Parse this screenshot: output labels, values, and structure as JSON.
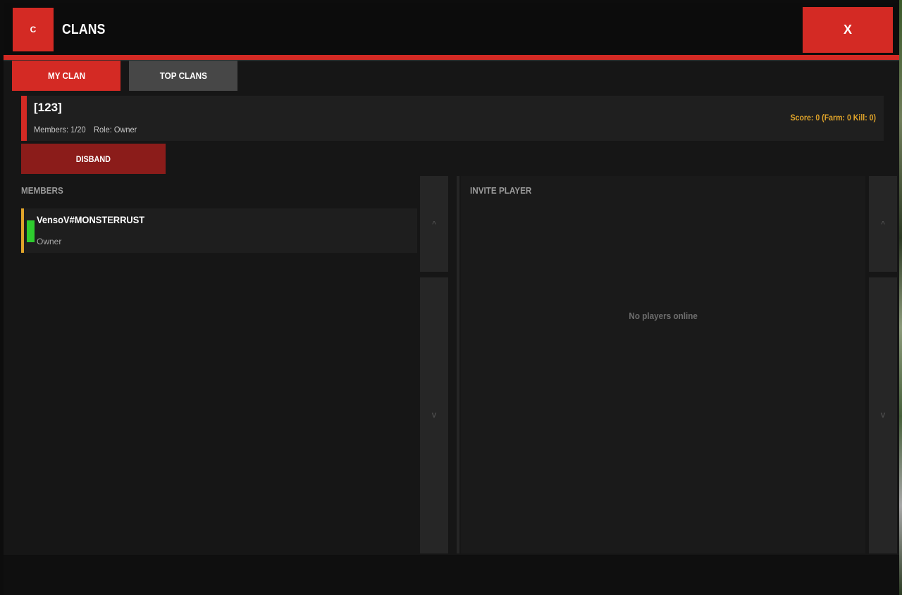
{
  "header": {
    "logo_letter": "C",
    "title": "CLANS",
    "close_label": "X"
  },
  "tabs": [
    {
      "label": "MY CLAN",
      "active": true
    },
    {
      "label": "TOP CLANS",
      "active": false
    }
  ],
  "clan": {
    "name": "[123]",
    "members_text": "Members: 1/20",
    "role_text": "Role: Owner",
    "score_text": "Score: 0  (Farm: 0 Kill: 0)"
  },
  "actions": {
    "disband_label": "DISBAND"
  },
  "members": {
    "label": "MEMBERS",
    "items": [
      {
        "name": "VensoV#MONSTERRUST",
        "role": "Owner",
        "online": true
      }
    ],
    "scroll_up": "^",
    "scroll_down": "V"
  },
  "invite": {
    "label": "INVITE PLAYER",
    "empty_text": "No players online",
    "scroll_up": "^",
    "scroll_down": "V"
  },
  "colors": {
    "accent_red": "#d42a24",
    "disband_red": "#8b1c1a",
    "score_gold": "#e0a42a",
    "online_green": "#2ecc2e"
  }
}
